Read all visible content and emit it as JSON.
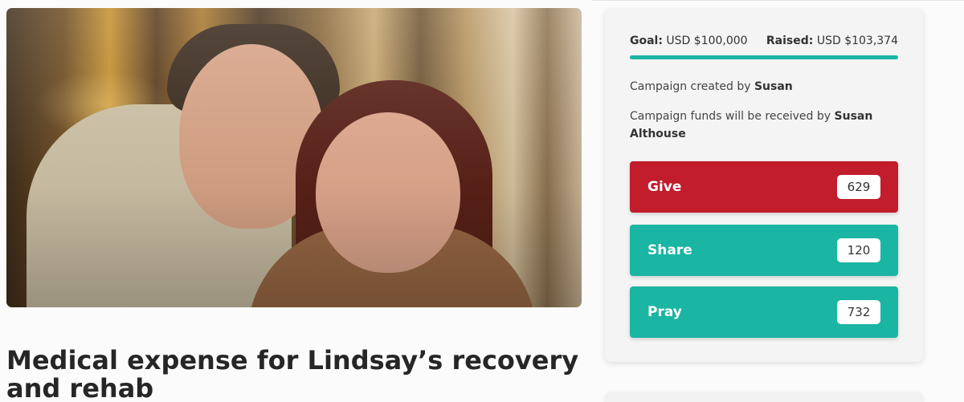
{
  "hero": {
    "image_alt": "Couple smiling together in a forest"
  },
  "campaign": {
    "title": "Medical expense for Lindsay’s recovery and rehab",
    "goal_label": "Goal:",
    "goal_value": "USD $100,000",
    "raised_label": "Raised:",
    "raised_value": "USD $103,374",
    "progress_fraction": 1.0,
    "created_prefix": "Campaign created by",
    "created_by": "Susan",
    "funds_prefix": "Campaign funds will be received by",
    "funds_recipient": "Susan Althouse"
  },
  "actions": {
    "give": {
      "label": "Give",
      "count": "629"
    },
    "share": {
      "label": "Share",
      "count": "120"
    },
    "pray": {
      "label": "Pray",
      "count": "732"
    }
  },
  "colors": {
    "give": "#c11d2c",
    "accent": "#1ab5a3"
  }
}
